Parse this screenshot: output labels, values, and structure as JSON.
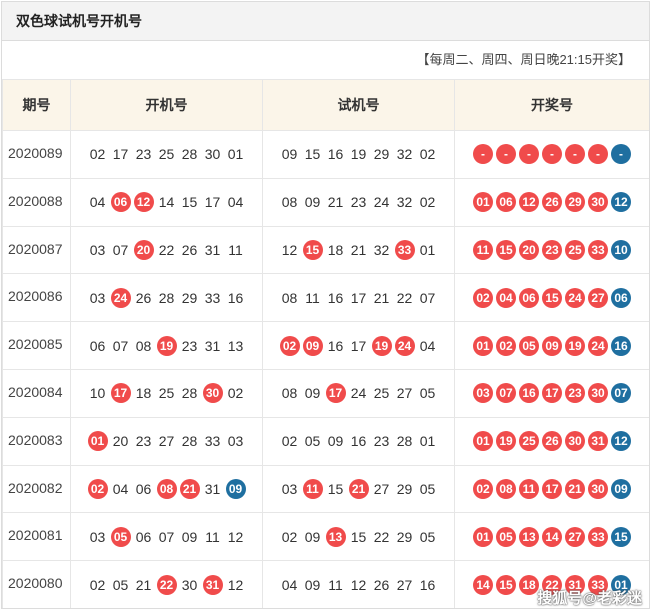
{
  "title": "双色球试机号开机号",
  "schedule": "【每周二、周四、周日晚21:15开奖】",
  "headers": {
    "issue": "期号",
    "open": "开机号",
    "trial": "试机号",
    "draw": "开奖号"
  },
  "colors": {
    "red_ball": "#f04b4b",
    "blue_ball": "#1f6fa0",
    "header_bg": "#fbf5e9"
  },
  "rows": [
    {
      "issue": "2020089",
      "open": [
        {
          "v": "02",
          "h": false
        },
        {
          "v": "17",
          "h": false
        },
        {
          "v": "23",
          "h": false
        },
        {
          "v": "25",
          "h": false
        },
        {
          "v": "28",
          "h": false
        },
        {
          "v": "30",
          "h": false
        },
        {
          "v": "01",
          "h": false
        }
      ],
      "trial": [
        {
          "v": "09",
          "h": false
        },
        {
          "v": "15",
          "h": false
        },
        {
          "v": "16",
          "h": false
        },
        {
          "v": "19",
          "h": false
        },
        {
          "v": "29",
          "h": false
        },
        {
          "v": "32",
          "h": false
        },
        {
          "v": "02",
          "h": false
        }
      ],
      "draw": [
        "-",
        "-",
        "-",
        "-",
        "-",
        "-",
        "-"
      ]
    },
    {
      "issue": "2020088",
      "open": [
        {
          "v": "04",
          "h": false
        },
        {
          "v": "06",
          "h": true
        },
        {
          "v": "12",
          "h": true
        },
        {
          "v": "14",
          "h": false
        },
        {
          "v": "15",
          "h": false
        },
        {
          "v": "17",
          "h": false
        },
        {
          "v": "04",
          "h": false
        }
      ],
      "trial": [
        {
          "v": "08",
          "h": false
        },
        {
          "v": "09",
          "h": false
        },
        {
          "v": "21",
          "h": false
        },
        {
          "v": "23",
          "h": false
        },
        {
          "v": "24",
          "h": false
        },
        {
          "v": "32",
          "h": false
        },
        {
          "v": "02",
          "h": false
        }
      ],
      "draw": [
        "01",
        "06",
        "12",
        "26",
        "29",
        "30",
        "12"
      ]
    },
    {
      "issue": "2020087",
      "open": [
        {
          "v": "03",
          "h": false
        },
        {
          "v": "07",
          "h": false
        },
        {
          "v": "20",
          "h": true
        },
        {
          "v": "22",
          "h": false
        },
        {
          "v": "26",
          "h": false
        },
        {
          "v": "31",
          "h": false
        },
        {
          "v": "11",
          "h": false
        }
      ],
      "trial": [
        {
          "v": "12",
          "h": false
        },
        {
          "v": "15",
          "h": true
        },
        {
          "v": "18",
          "h": false
        },
        {
          "v": "21",
          "h": false
        },
        {
          "v": "32",
          "h": false
        },
        {
          "v": "33",
          "h": true
        },
        {
          "v": "01",
          "h": false
        }
      ],
      "draw": [
        "11",
        "15",
        "20",
        "23",
        "25",
        "33",
        "10"
      ]
    },
    {
      "issue": "2020086",
      "open": [
        {
          "v": "03",
          "h": false
        },
        {
          "v": "24",
          "h": true
        },
        {
          "v": "26",
          "h": false
        },
        {
          "v": "28",
          "h": false
        },
        {
          "v": "29",
          "h": false
        },
        {
          "v": "33",
          "h": false
        },
        {
          "v": "16",
          "h": false
        }
      ],
      "trial": [
        {
          "v": "08",
          "h": false
        },
        {
          "v": "11",
          "h": false
        },
        {
          "v": "16",
          "h": false
        },
        {
          "v": "17",
          "h": false
        },
        {
          "v": "21",
          "h": false
        },
        {
          "v": "22",
          "h": false
        },
        {
          "v": "07",
          "h": false
        }
      ],
      "draw": [
        "02",
        "04",
        "06",
        "15",
        "24",
        "27",
        "06"
      ]
    },
    {
      "issue": "2020085",
      "open": [
        {
          "v": "06",
          "h": false
        },
        {
          "v": "07",
          "h": false
        },
        {
          "v": "08",
          "h": false
        },
        {
          "v": "19",
          "h": true
        },
        {
          "v": "23",
          "h": false
        },
        {
          "v": "31",
          "h": false
        },
        {
          "v": "13",
          "h": false
        }
      ],
      "trial": [
        {
          "v": "02",
          "h": true
        },
        {
          "v": "09",
          "h": true
        },
        {
          "v": "16",
          "h": false
        },
        {
          "v": "17",
          "h": false
        },
        {
          "v": "19",
          "h": true
        },
        {
          "v": "24",
          "h": true
        },
        {
          "v": "04",
          "h": false
        }
      ],
      "draw": [
        "01",
        "02",
        "05",
        "09",
        "19",
        "24",
        "16"
      ]
    },
    {
      "issue": "2020084",
      "open": [
        {
          "v": "10",
          "h": false
        },
        {
          "v": "17",
          "h": true
        },
        {
          "v": "18",
          "h": false
        },
        {
          "v": "25",
          "h": false
        },
        {
          "v": "28",
          "h": false
        },
        {
          "v": "30",
          "h": true
        },
        {
          "v": "02",
          "h": false
        }
      ],
      "trial": [
        {
          "v": "08",
          "h": false
        },
        {
          "v": "09",
          "h": false
        },
        {
          "v": "17",
          "h": true
        },
        {
          "v": "24",
          "h": false
        },
        {
          "v": "25",
          "h": false
        },
        {
          "v": "27",
          "h": false
        },
        {
          "v": "05",
          "h": false
        }
      ],
      "draw": [
        "03",
        "07",
        "16",
        "17",
        "23",
        "30",
        "07"
      ]
    },
    {
      "issue": "2020083",
      "open": [
        {
          "v": "01",
          "h": true
        },
        {
          "v": "20",
          "h": false
        },
        {
          "v": "23",
          "h": false
        },
        {
          "v": "27",
          "h": false
        },
        {
          "v": "28",
          "h": false
        },
        {
          "v": "33",
          "h": false
        },
        {
          "v": "03",
          "h": false
        }
      ],
      "trial": [
        {
          "v": "02",
          "h": false
        },
        {
          "v": "05",
          "h": false
        },
        {
          "v": "09",
          "h": false
        },
        {
          "v": "16",
          "h": false
        },
        {
          "v": "23",
          "h": false
        },
        {
          "v": "28",
          "h": false
        },
        {
          "v": "01",
          "h": false
        }
      ],
      "draw": [
        "01",
        "19",
        "25",
        "26",
        "30",
        "31",
        "12"
      ]
    },
    {
      "issue": "2020082",
      "open": [
        {
          "v": "02",
          "h": true
        },
        {
          "v": "04",
          "h": false
        },
        {
          "v": "06",
          "h": false
        },
        {
          "v": "08",
          "h": true
        },
        {
          "v": "21",
          "h": true
        },
        {
          "v": "31",
          "h": false
        },
        {
          "v": "09",
          "h": "blue"
        }
      ],
      "trial": [
        {
          "v": "03",
          "h": false
        },
        {
          "v": "11",
          "h": true
        },
        {
          "v": "15",
          "h": false
        },
        {
          "v": "21",
          "h": true
        },
        {
          "v": "27",
          "h": false
        },
        {
          "v": "29",
          "h": false
        },
        {
          "v": "05",
          "h": false
        }
      ],
      "draw": [
        "02",
        "08",
        "11",
        "17",
        "21",
        "30",
        "09"
      ]
    },
    {
      "issue": "2020081",
      "open": [
        {
          "v": "03",
          "h": false
        },
        {
          "v": "05",
          "h": true
        },
        {
          "v": "06",
          "h": false
        },
        {
          "v": "07",
          "h": false
        },
        {
          "v": "09",
          "h": false
        },
        {
          "v": "11",
          "h": false
        },
        {
          "v": "12",
          "h": false
        }
      ],
      "trial": [
        {
          "v": "02",
          "h": false
        },
        {
          "v": "09",
          "h": false
        },
        {
          "v": "13",
          "h": true
        },
        {
          "v": "15",
          "h": false
        },
        {
          "v": "22",
          "h": false
        },
        {
          "v": "29",
          "h": false
        },
        {
          "v": "05",
          "h": false
        }
      ],
      "draw": [
        "01",
        "05",
        "13",
        "14",
        "27",
        "33",
        "15"
      ]
    },
    {
      "issue": "2020080",
      "open": [
        {
          "v": "02",
          "h": false
        },
        {
          "v": "05",
          "h": false
        },
        {
          "v": "21",
          "h": false
        },
        {
          "v": "22",
          "h": true
        },
        {
          "v": "30",
          "h": false
        },
        {
          "v": "31",
          "h": true
        },
        {
          "v": "12",
          "h": false
        }
      ],
      "trial": [
        {
          "v": "04",
          "h": false
        },
        {
          "v": "09",
          "h": false
        },
        {
          "v": "11",
          "h": false
        },
        {
          "v": "12",
          "h": false
        },
        {
          "v": "26",
          "h": false
        },
        {
          "v": "27",
          "h": false
        },
        {
          "v": "16",
          "h": false
        }
      ],
      "draw": [
        "14",
        "15",
        "18",
        "22",
        "31",
        "33",
        "01"
      ]
    }
  ],
  "watermark": "搜狐号@老彩迷"
}
